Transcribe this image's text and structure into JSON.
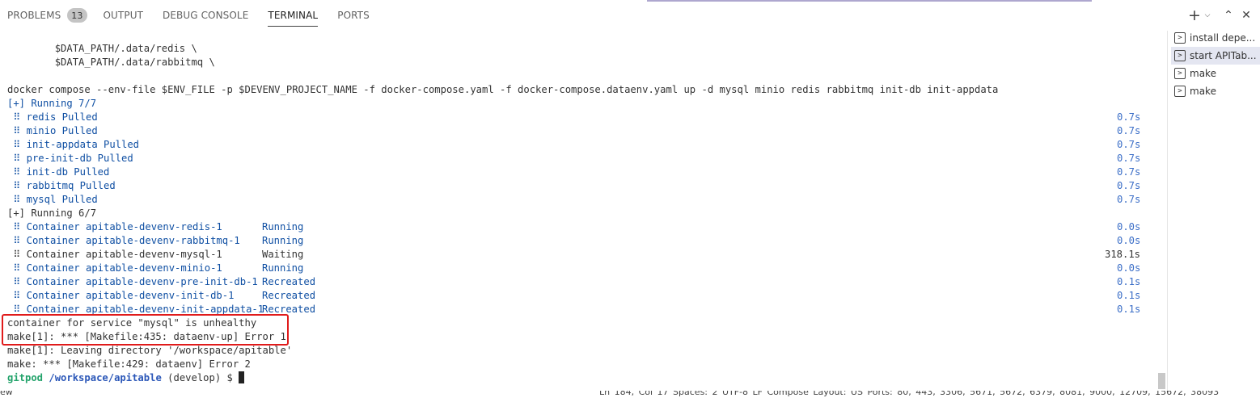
{
  "panel_tabs": [
    {
      "label": "PROBLEMS",
      "badge": "13"
    },
    {
      "label": "OUTPUT"
    },
    {
      "label": "DEBUG CONSOLE"
    },
    {
      "label": "TERMINAL",
      "active": true
    },
    {
      "label": "PORTS"
    }
  ],
  "panel_actions": [
    {
      "name": "new-terminal",
      "icon": "plus-icon",
      "glyph": "+"
    },
    {
      "name": "launch-profile",
      "icon": "chevron-down-icon",
      "glyph": "⌵"
    },
    {
      "name": "maximize-panel",
      "icon": "chevron-up-icon",
      "glyph": "⌃"
    },
    {
      "name": "close-panel",
      "icon": "close-icon",
      "glyph": "✕"
    }
  ],
  "terminal": {
    "lines": {
      "l0": "        $DATA_PATH/.data/redis \\",
      "l1": "        $DATA_PATH/.data/rabbitmq \\",
      "l2": "",
      "l3": "docker compose --env-file $ENV_FILE -p $DEVENV_PROJECT_NAME -f docker-compose.yaml -f docker-compose.dataenv.yaml up -d mysql minio redis rabbitmq init-db init-appdata",
      "l4": "[+] Running 7/7",
      "l5": " ⠿ redis Pulled",
      "l6": " ⠿ minio Pulled",
      "l7": " ⠿ init-appdata Pulled",
      "l8": " ⠿ pre-init-db Pulled",
      "l9": " ⠿ init-db Pulled",
      "l10": " ⠿ rabbitmq Pulled",
      "l11": " ⠿ mysql Pulled",
      "l12": "[+] Running 6/7",
      "l13": " ⠿ Container apitable-devenv-redis-1",
      "l14": " ⠿ Container apitable-devenv-rabbitmq-1",
      "l15": " ⠿ Container apitable-devenv-mysql-1",
      "l16": " ⠿ Container apitable-devenv-minio-1",
      "l17": " ⠿ Container apitable-devenv-pre-init-db-1",
      "l18": " ⠿ Container apitable-devenv-init-db-1",
      "l19": " ⠿ Container apitable-devenv-init-appdata-1",
      "l20": "container for service \"mysql\" is unhealthy",
      "l21": "make[1]: *** [Makefile:435: dataenv-up] Error 1",
      "l22": "make[1]: Leaving directory '/workspace/apitable'",
      "l23": "make: *** [Makefile:429: dataenv] Error 2"
    },
    "status": {
      "s13": "Running",
      "s14": "Running",
      "s15": "Waiting",
      "s16": "Running",
      "s17": "Recreated",
      "s18": "Recreated",
      "s19": "Recreated"
    },
    "durations": {
      "d5": "0.7s",
      "d6": "0.7s",
      "d7": "0.7s",
      "d8": "0.7s",
      "d9": "0.7s",
      "d10": "0.7s",
      "d11": "0.7s",
      "d13": "0.0s",
      "d14": "0.0s",
      "d15": "318.1s",
      "d16": "0.0s",
      "d17": "0.1s",
      "d18": "0.1s",
      "d19": "0.1s"
    },
    "prompt": {
      "user": "gitpod",
      "path": "/workspace/apitable",
      "branch": "(develop)",
      "symbol": "$"
    }
  },
  "terminal_list": [
    {
      "label": "install depe...",
      "icon": "terminal-icon"
    },
    {
      "label": "start APITab...",
      "icon": "terminal-icon",
      "active": true
    },
    {
      "label": "make",
      "icon": "terminal-icon"
    },
    {
      "label": "make",
      "icon": "terminal-icon"
    }
  ],
  "status_bar": {
    "left": "ew",
    "right": "Ln 184, Col 17   Spaces: 2   UTF-8   LF   Compose   Layout: US   Ports: 80, 443, 3306, 5671, 5672, 6379, 8081, 9000, 12709, 15672, 38093"
  },
  "colors": {
    "accent_text": "#0f4fa3",
    "prompt_green": "#23a36b",
    "highlight_border": "#e01b1b"
  }
}
